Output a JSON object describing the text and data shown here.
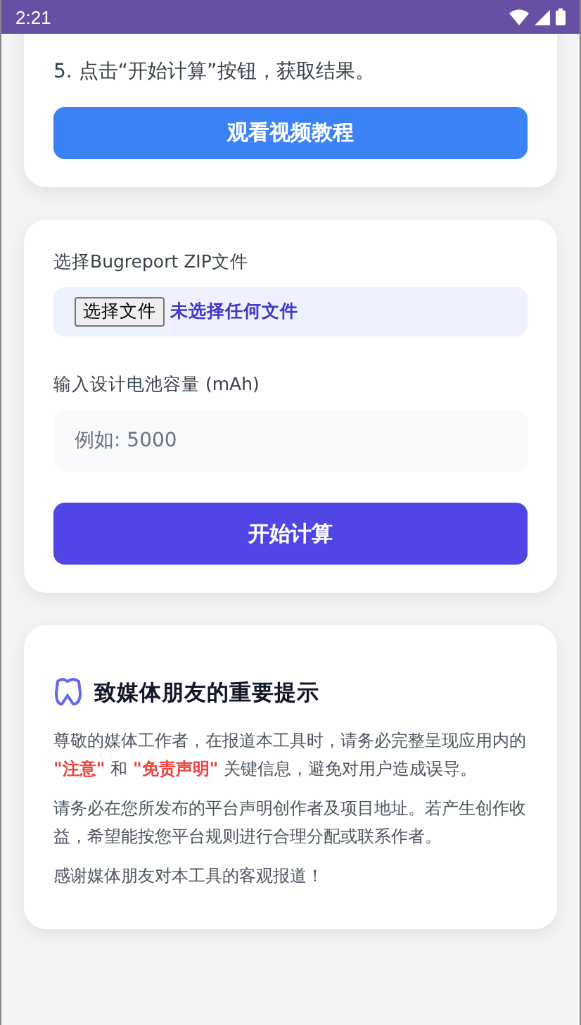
{
  "status_bar": {
    "time": "2:21"
  },
  "steps_card": {
    "lines": [
      "5. 点击“开始计算”按钮，获取结果。"
    ],
    "button": "观看视频教程"
  },
  "form_card": {
    "file_label": "选择Bugreport ZIP文件",
    "file_button": "选择文件",
    "file_status": "未选择任何文件",
    "capacity_label": "输入设计电池容量 (mAh)",
    "capacity_placeholder": "例如: 5000",
    "submit": "开始计算"
  },
  "notice_card": {
    "title": "致媒体朋友的重要提示",
    "paragraphs": [
      "尊敬的媒体工作者，在报道本工具时，请务必完整呈现应用内的 **\"注意\"** 和 **\"免责声明\"** 关键信息，避免对用户造成误导。",
      "请务必在您所发布的平台声明创作者及项目地址。若产生创作收益，希望能按您平台规则进行合理分配或联系作者。",
      "感谢媒体朋友对本工具的客观报道！"
    ]
  }
}
